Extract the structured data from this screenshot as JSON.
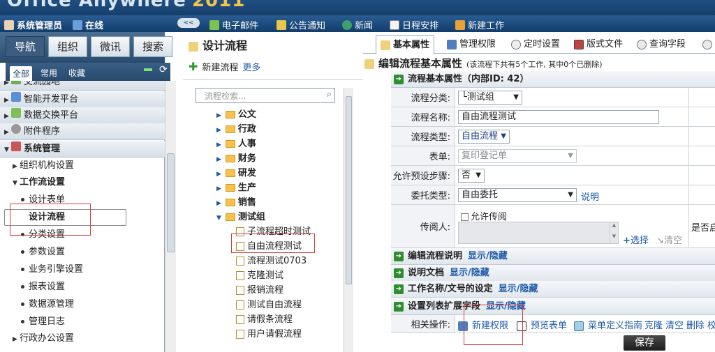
{
  "app": {
    "brand": "Office Anywhere",
    "year": "2011"
  },
  "userbar": {
    "user": "系统管理员",
    "status": "在线",
    "items": [
      "电子邮件",
      "公告通知",
      "新闻",
      "日程安排",
      "新建工作"
    ]
  },
  "left": {
    "tabs": [
      "导航",
      "组织",
      "微讯",
      "搜索"
    ],
    "subtabs": [
      "全部",
      "常用",
      "收藏"
    ],
    "rows": [
      {
        "label": "交流园地",
        "type": "grp"
      },
      {
        "label": "智能开发平台",
        "type": "grp"
      },
      {
        "label": "数据交换平台",
        "type": "grp"
      },
      {
        "label": "附件程序",
        "type": "grp"
      },
      {
        "label": "系统管理",
        "type": "grpopen"
      },
      {
        "label": "组织机构设置",
        "type": "sub"
      },
      {
        "label": "工作流设置",
        "type": "subopen"
      },
      {
        "label": "设计表单",
        "type": "leaf"
      },
      {
        "label": "设计流程",
        "type": "leafsel"
      },
      {
        "label": "分类设置",
        "type": "leaf"
      },
      {
        "label": "参数设置",
        "type": "leaf"
      },
      {
        "label": "业务引擎设置",
        "type": "leaf"
      },
      {
        "label": "报表设置",
        "type": "leaf"
      },
      {
        "label": "数据源管理",
        "type": "leaf"
      },
      {
        "label": "管理日志",
        "type": "leaf"
      },
      {
        "label": "行政办公设置",
        "type": "sub"
      }
    ]
  },
  "middle": {
    "title": "设计流程",
    "new_flow": "新建流程",
    "more": "更多",
    "search_placeholder": "流程检索...",
    "folders": [
      "公文",
      "行政",
      "人事",
      "财务",
      "研发",
      "生产",
      "销售",
      "测试组"
    ],
    "items": [
      "子流程超时测试",
      "自由流程测试",
      "流程测试0703",
      "克隆测试",
      "报销流程",
      "测试自由流程",
      "请假条流程",
      "用户请假流程"
    ]
  },
  "right": {
    "tabs": [
      "基本属性",
      "管理权限",
      "定时设置",
      "版式文件",
      "查询字段"
    ],
    "heading": "编辑流程基本属性",
    "note": "(该流程下共有5个工作, 其中0个已删除)",
    "section_title": "流程基本属性（内部ID: 42）",
    "fields": {
      "category": {
        "label": "流程分类:",
        "value": "└测试组"
      },
      "name": {
        "label": "流程名称:",
        "value": "自由流程测试"
      },
      "type": {
        "label": "流程类型:",
        "value": "自由流程"
      },
      "form": {
        "label": "表单:",
        "value": "复印登记单"
      },
      "presteps": {
        "label": "允许预设步骤:",
        "value": "否"
      },
      "delegate": {
        "label": "委托类型:",
        "value": "自由委托",
        "help": "说明"
      },
      "reader": {
        "label": "传阅人:",
        "checkbox": "允许传阅",
        "select": "选择",
        "clear": "清空"
      },
      "extra": "是否启"
    },
    "sections": [
      {
        "title": "编辑流程说明",
        "toggle": "显示/隐藏"
      },
      {
        "title": "说明文档",
        "toggle": "显示/隐藏"
      },
      {
        "title": "工作名称/文号的设定",
        "toggle": "显示/隐藏"
      },
      {
        "title": "设置列表扩展字段",
        "toggle": "显示/隐藏"
      }
    ],
    "ops": {
      "label": "相关操作:",
      "items": [
        "新建权限",
        "预览表单",
        "菜单定义指南",
        "克隆",
        "清空",
        "删除",
        "校"
      ]
    },
    "save": "保存"
  },
  "colors": {
    "header": "#1f4f82",
    "accent": "#1e5aa8",
    "red": "#d63a3a"
  }
}
